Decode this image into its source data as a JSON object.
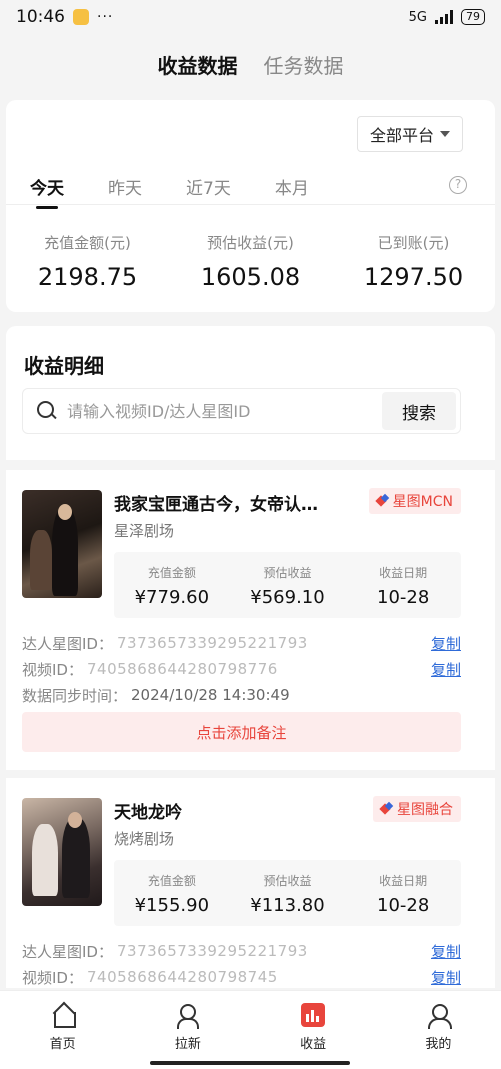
{
  "status_bar": {
    "time": "10:46",
    "dots": "···",
    "network": "5G",
    "battery": "79"
  },
  "top_tabs": {
    "active": "收益数据",
    "other": "任务数据"
  },
  "summary": {
    "platform_select": "全部平台",
    "period_tabs": [
      "今天",
      "昨天",
      "近7天",
      "本月"
    ],
    "help": "?",
    "metrics": [
      {
        "label": "充值金额(元)",
        "value": "2198.75"
      },
      {
        "label": "预估收益(元)",
        "value": "1605.08"
      },
      {
        "label": "已到账(元)",
        "value": "1297.50"
      }
    ]
  },
  "details": {
    "title": "收益明细",
    "search_placeholder": "请输入视频ID/达人星图ID",
    "search_button": "搜索"
  },
  "records": [
    {
      "title": "我家宝匣通古今，女帝认…",
      "studio": "星泽剧场",
      "tag": "星图MCN",
      "stats": [
        {
          "label": "充值金额",
          "value": "¥779.60"
        },
        {
          "label": "预估收益",
          "value": "¥569.10"
        },
        {
          "label": "收益日期",
          "value": "10-28"
        }
      ],
      "star_id_label": "达人星图ID：",
      "star_id": "7373657339295221793",
      "video_id_label": "视频ID：",
      "video_id": "7405868644280798776",
      "sync_label": "数据同步时间：",
      "sync_time": "2024/10/28 14:30:49",
      "copy": "复制",
      "remark": "点击添加备注"
    },
    {
      "title": "天地龙吟",
      "studio": "烧烤剧场",
      "tag": "星图融合",
      "stats": [
        {
          "label": "充值金额",
          "value": "¥155.90"
        },
        {
          "label": "预估收益",
          "value": "¥113.80"
        },
        {
          "label": "收益日期",
          "value": "10-28"
        }
      ],
      "star_id_label": "达人星图ID：",
      "star_id": "7373657339295221793",
      "video_id_label": "视频ID：",
      "video_id": "7405868644280798745",
      "copy": "复制"
    }
  ],
  "bottom_nav": [
    "首页",
    "拉新",
    "收益",
    "我的"
  ],
  "colors": {
    "accent": "#e8453c",
    "link": "#2f6bd8"
  }
}
